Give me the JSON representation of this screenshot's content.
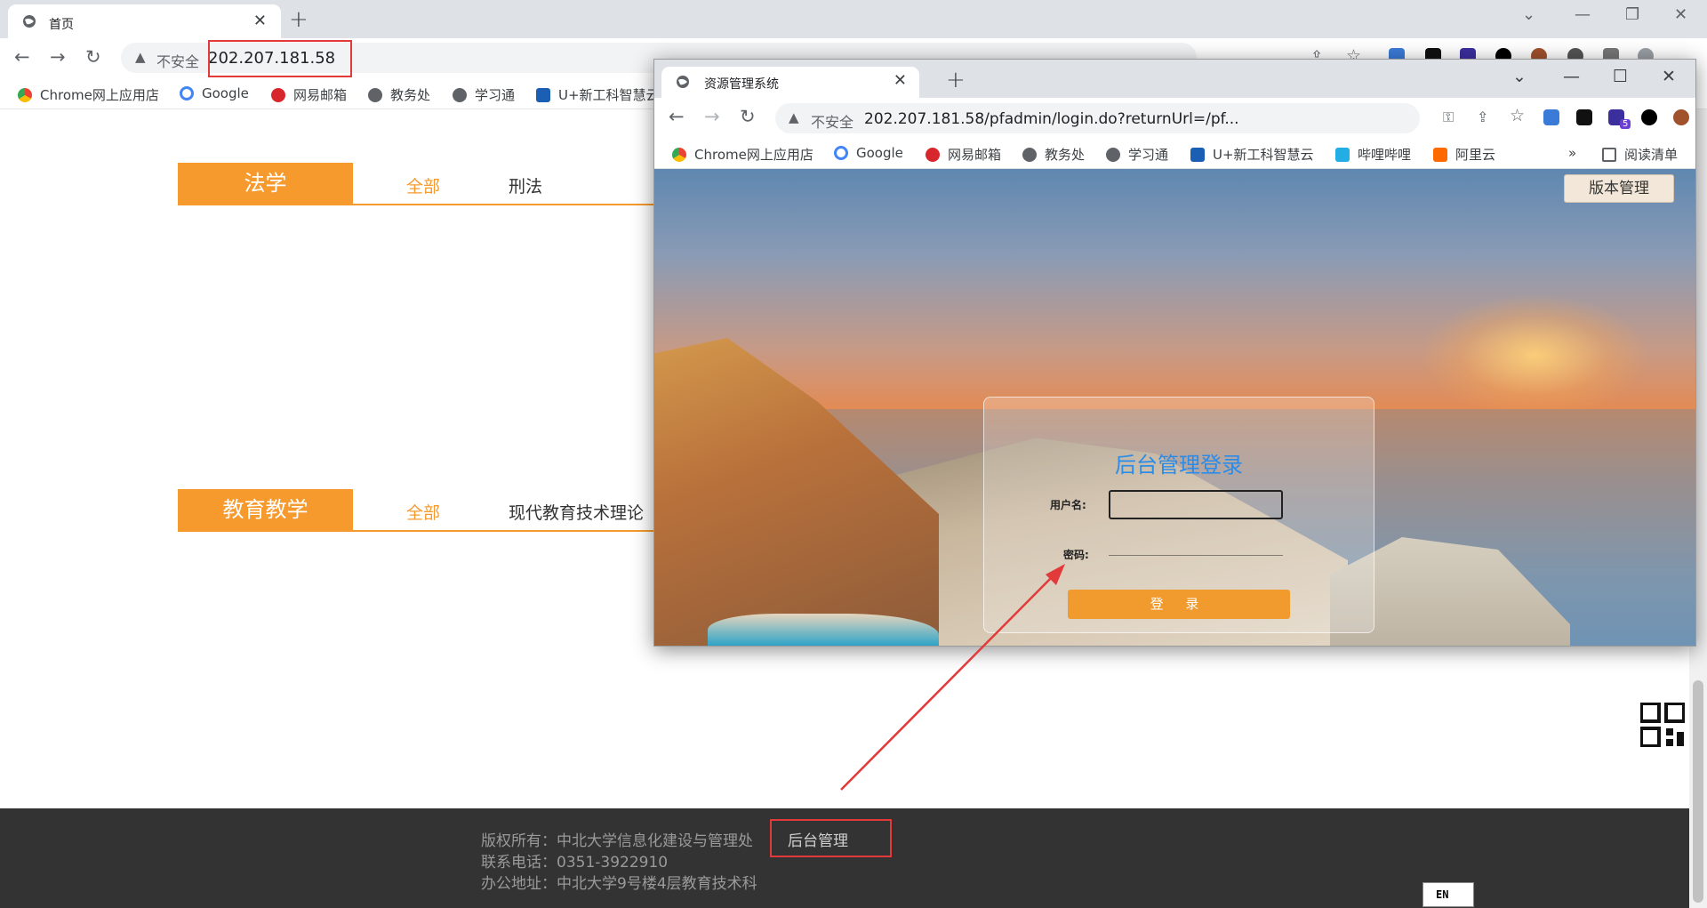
{
  "outer_browser": {
    "tab_title": "首页",
    "new_tab": "+",
    "tab_close": "✕",
    "security_label": "不安全",
    "url": "202.207.181.58",
    "bookmarks": [
      "Chrome网上应用店",
      "Google",
      "网易邮箱",
      "教务处",
      "学习通",
      "U+新工科智慧云"
    ]
  },
  "page": {
    "sections": [
      {
        "title": "法学",
        "tabs": [
          "全部",
          "刑法"
        ]
      },
      {
        "title": "教育教学",
        "tabs": [
          "全部",
          "现代教育技术理论"
        ]
      }
    ],
    "footer": {
      "copyright": "版权所有：中北大学信息化建设与管理处",
      "admin_link": "后台管理",
      "phone": "联系电话：0351-3922910",
      "address": "办公地址：中北大学9号楼4层教育技术科"
    },
    "ime_indicator": "EN"
  },
  "popup_browser": {
    "tab_title": "资源管理系统",
    "security_label": "不安全",
    "url": "202.207.181.58/pfadmin/login.do?returnUrl=/pf...",
    "bookmarks": [
      "Chrome网上应用店",
      "Google",
      "网易邮箱",
      "教务处",
      "学习通",
      "U+新工科智慧云",
      "哔哩哔哩",
      "阿里云"
    ],
    "bookmarks_more": "»",
    "reading_list": "阅读清单",
    "extension_badge": "5",
    "version_button": "版本管理",
    "login": {
      "title": "后台管理登录",
      "username_label": "用户名:",
      "password_label": "密码:",
      "submit": "登 录"
    }
  },
  "colors": {
    "accent_orange": "#f79a2e",
    "login_title_blue": "#2a8ce8",
    "highlight_red": "#e23a3a",
    "footer_bg": "#333333"
  }
}
